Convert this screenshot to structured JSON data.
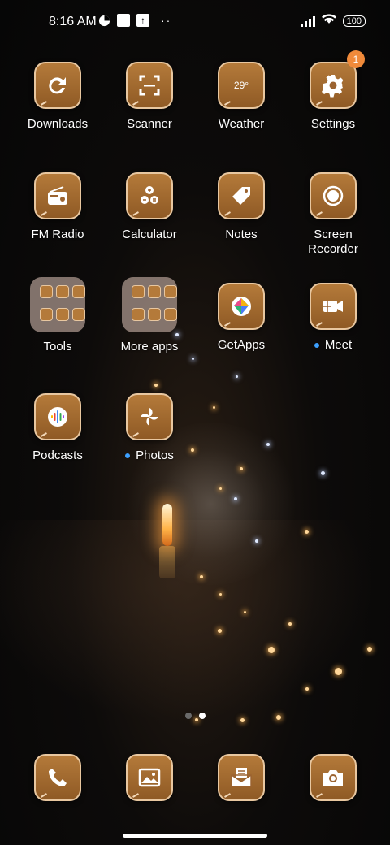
{
  "status_bar": {
    "time": "8:16 AM",
    "battery": "100",
    "more_dots": "··"
  },
  "apps": [
    {
      "label": "Downloads",
      "icon": "refresh-icon"
    },
    {
      "label": "Scanner",
      "icon": "scan-frame-icon"
    },
    {
      "label": "Weather",
      "icon": "weather-icon",
      "value": "29°"
    },
    {
      "label": "Settings",
      "icon": "gear-icon",
      "badge": "1"
    },
    {
      "label": "FM Radio",
      "icon": "radio-icon"
    },
    {
      "label": "Calculator",
      "icon": "calculator-icon"
    },
    {
      "label": "Notes",
      "icon": "tag-icon"
    },
    {
      "label": "Screen Recorder",
      "icon": "record-icon"
    },
    {
      "label": "Tools",
      "icon": "folder-icon"
    },
    {
      "label": "More apps",
      "icon": "folder-icon"
    },
    {
      "label": "GetApps",
      "icon": "getapps-icon"
    },
    {
      "label": "Meet",
      "icon": "video-camera-icon",
      "new_dot": true
    },
    {
      "label": "Podcasts",
      "icon": "podcasts-icon"
    },
    {
      "label": "Photos",
      "icon": "pinwheel-icon",
      "new_dot": true
    }
  ],
  "dock": [
    {
      "icon": "phone-icon"
    },
    {
      "icon": "gallery-icon"
    },
    {
      "icon": "messages-icon"
    },
    {
      "icon": "camera-icon"
    }
  ],
  "pager": {
    "pages": 2,
    "active": 2
  },
  "colors": {
    "icon_bg": "#a06a30",
    "badge": "#f08a3a",
    "new_dot": "#3da0ff"
  }
}
